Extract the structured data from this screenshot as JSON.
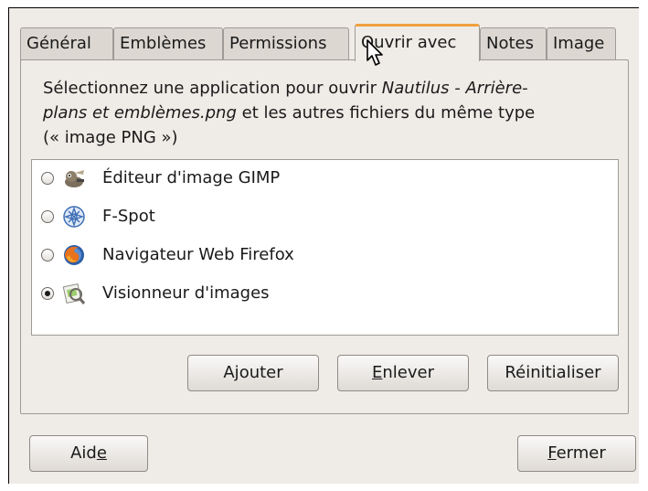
{
  "tabs": [
    "Général",
    "Emblèmes",
    "Permissions",
    "Ouvrir avec",
    "Notes",
    "Image"
  ],
  "active_tab": "Ouvrir avec",
  "description": {
    "part1": "Sélectionnez une application pour ouvrir ",
    "filename": "Nautilus - Arrière-plans et emblèmes.png",
    "part2": " et les autres fichiers du même type (« image PNG »)"
  },
  "apps": [
    {
      "label": "Éditeur d'image GIMP",
      "icon": "gimp-icon",
      "selected": false
    },
    {
      "label": "F-Spot",
      "icon": "f-spot-icon",
      "selected": false
    },
    {
      "label": "Navigateur Web Firefox",
      "icon": "firefox-icon",
      "selected": false
    },
    {
      "label": "Visionneur d'images",
      "icon": "image-viewer-icon",
      "selected": true
    }
  ],
  "buttons": {
    "add": {
      "before": "A",
      "mnemonic": "j",
      "after": "outer"
    },
    "remove": {
      "before": "",
      "mnemonic": "E",
      "after": "nlever"
    },
    "reset": {
      "before": "Réinitialiser",
      "mnemonic": "",
      "after": ""
    },
    "help": {
      "before": "Aid",
      "mnemonic": "e",
      "after": ""
    },
    "close": {
      "before": "",
      "mnemonic": "F",
      "after": "ermer"
    }
  },
  "colors": {
    "window_bg": "#efebe7",
    "active_tab_accent": "#f0a040",
    "list_bg": "#ffffff"
  }
}
